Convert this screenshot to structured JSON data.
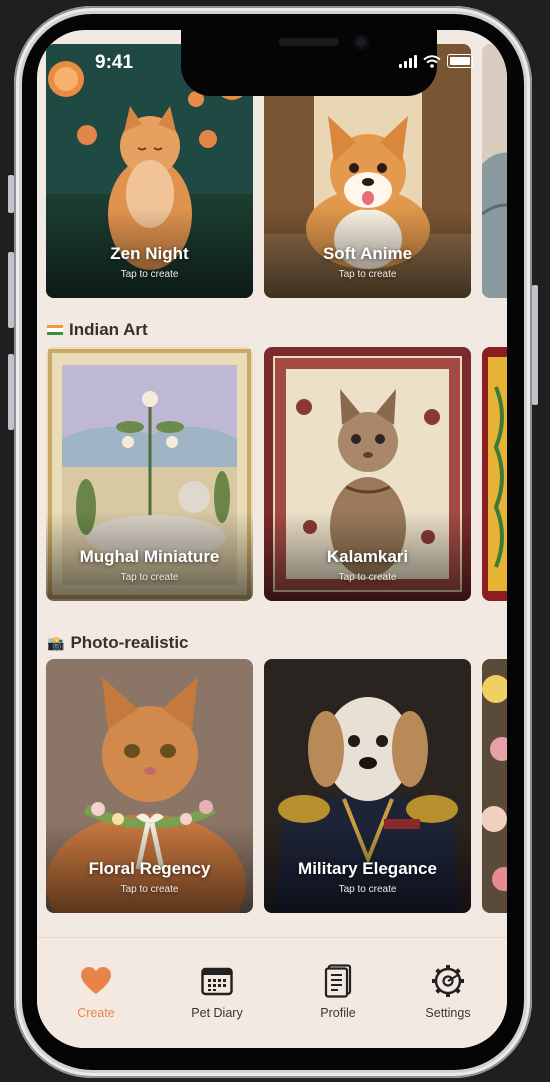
{
  "status_bar": {
    "time": "9:41"
  },
  "sections": [
    {
      "title": "",
      "cards": [
        {
          "label": "Zen Night",
          "sub": "Tap to create"
        },
        {
          "label": "Soft Anime",
          "sub": "Tap to create"
        }
      ]
    },
    {
      "title": "Indian Art",
      "cards": [
        {
          "label": "Mughal Miniature",
          "sub": "Tap to create"
        },
        {
          "label": "Kalamkari",
          "sub": "Tap to create"
        }
      ]
    },
    {
      "title": "Photo-realistic",
      "cards": [
        {
          "label": "Floral Regency",
          "sub": "Tap to create"
        },
        {
          "label": "Military Elegance",
          "sub": "Tap to create"
        }
      ]
    }
  ],
  "tabbar": {
    "items": [
      {
        "label": "Create",
        "icon": "heart-icon",
        "active": true
      },
      {
        "label": "Pet Diary",
        "icon": "calendar-icon",
        "active": false
      },
      {
        "label": "Profile",
        "icon": "document-icon",
        "active": false
      },
      {
        "label": "Settings",
        "icon": "gear-icon",
        "active": false
      }
    ]
  },
  "colors": {
    "accent": "#e8844a",
    "background": "#f3e9e3"
  }
}
